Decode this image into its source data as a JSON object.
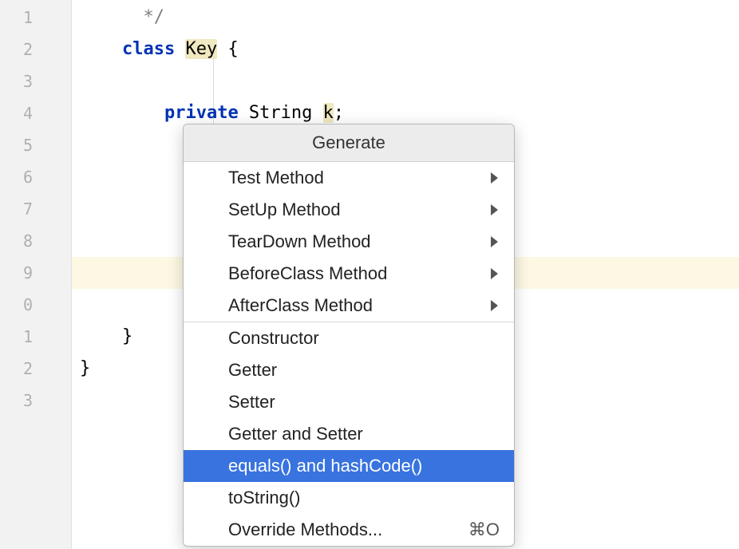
{
  "gutter": {
    "lines": [
      "1",
      "2",
      "3",
      "4",
      "5",
      "6",
      "7",
      "8",
      "9",
      "0",
      "1",
      "2",
      "3"
    ]
  },
  "code": {
    "line0_comment": "*/",
    "line1_class": "class",
    "line1_name": "Key",
    "line1_brace": " {",
    "line3_private": "private",
    "line3_type": " String ",
    "line3_var": "k",
    "line3_semi": ";",
    "line11_brace": "}",
    "line12_brace": "}"
  },
  "popup": {
    "title": "Generate",
    "items_group1": [
      {
        "label": "Test Method",
        "submenu": true
      },
      {
        "label": "SetUp Method",
        "submenu": true
      },
      {
        "label": "TearDown Method",
        "submenu": true
      },
      {
        "label": "BeforeClass Method",
        "submenu": true
      },
      {
        "label": "AfterClass Method",
        "submenu": true
      }
    ],
    "items_group2": [
      {
        "label": "Constructor"
      },
      {
        "label": "Getter"
      },
      {
        "label": "Setter"
      },
      {
        "label": "Getter and Setter"
      },
      {
        "label": "equals() and hashCode()",
        "selected": true
      },
      {
        "label": "toString()"
      },
      {
        "label": "Override Methods...",
        "shortcut": "⌘O"
      }
    ]
  }
}
